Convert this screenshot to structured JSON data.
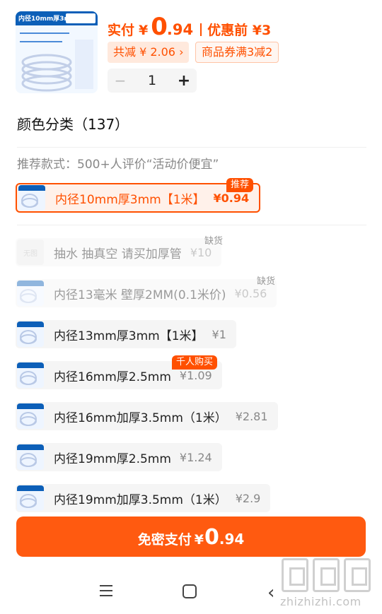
{
  "product": {
    "image_banner_text": "内径10mm厚3mm",
    "price_label": "实付",
    "currency": "¥",
    "price_integer": "0",
    "price_decimal": ".94",
    "before_discount": "优惠前 ¥3",
    "total_saving": "共减 ¥ 2.06 ›",
    "coupon": "商品券满3减2"
  },
  "stepper": {
    "minus": "−",
    "quantity": "1",
    "plus": "+"
  },
  "variants": {
    "title": "颜色分类（137）",
    "recommend_line": "推荐款式：500+人评价“活动价便宜”",
    "recommend_badge": "推荐",
    "hot_badge": "千人购买",
    "out_of_stock": "缺货",
    "no_image": "无图",
    "options": [
      {
        "label": "内径10mm厚3mm【1米】",
        "price": "¥0.94"
      },
      {
        "label": "抽水 抽真空 请买加厚管",
        "price": "¥10"
      },
      {
        "label": "内径13毫米 壁厚2MM(0.1米价)",
        "price": "¥0.56"
      },
      {
        "label": "内径13mm厚3mm【1米】",
        "price": "¥1"
      },
      {
        "label": "内径16mm厚2.5mm",
        "price": "¥1.09"
      },
      {
        "label": "内径16mm加厚3.5mm（1米）",
        "price": "¥2.81"
      },
      {
        "label": "内径19mm厚2.5mm",
        "price": "¥1.24"
      },
      {
        "label": "内径19mm加厚3.5mm（1米）",
        "price": "¥2.9"
      }
    ]
  },
  "pay_button": {
    "label": "免密支付",
    "currency": "¥",
    "integer": "0",
    "decimal": ".94"
  },
  "watermark": {
    "text": "zhizhizhi.com"
  },
  "colors": {
    "accent": "#ff5000",
    "selected_bg": "#fff1ea",
    "option_bg": "#f5f5f5"
  }
}
